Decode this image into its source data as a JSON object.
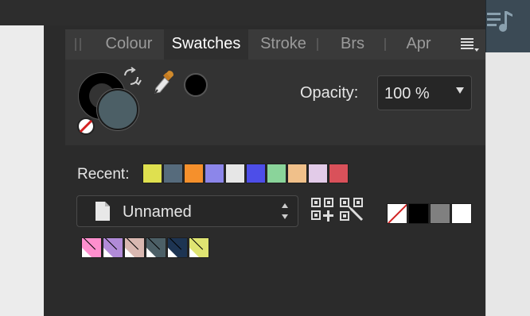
{
  "tabs": [
    {
      "label": "Colour",
      "active": false
    },
    {
      "label": "Swatches",
      "active": true
    },
    {
      "label": "Stroke",
      "active": false
    },
    {
      "label": "Brs",
      "active": false
    },
    {
      "label": "Apr",
      "active": false
    }
  ],
  "colour": {
    "stroke_color": "#000000",
    "fill_color": "#4c5f66",
    "picked_color": "#000000",
    "opacity_label": "Opacity:",
    "opacity_value": "100 %"
  },
  "recent": {
    "label": "Recent:",
    "colors": [
      "#dfe04f",
      "#566b7c",
      "#f5902c",
      "#8c86ea",
      "#e6e6e6",
      "#4d4ee8",
      "#8ad49a",
      "#f0c08a",
      "#e2cbe8",
      "#d9515a"
    ]
  },
  "palette": {
    "name": "Unnamed"
  },
  "basic_swatches": [
    "none",
    "#000000",
    "#808080",
    "#ffffff"
  ],
  "document_swatches": [
    "#ff8fce",
    "#b18bd8",
    "#d9b8b1",
    "#4c5f66",
    "#1d3452",
    "#dfe472"
  ],
  "icons": {
    "tabs_menu": "panel-menu-icon",
    "swap": "swap-colors-icon",
    "none": "no-fill-icon",
    "picker": "eyedropper-icon",
    "document": "document-icon",
    "add": "add-swatch-icon",
    "edit": "edit-swatch-icon",
    "music": "music-list-icon"
  }
}
